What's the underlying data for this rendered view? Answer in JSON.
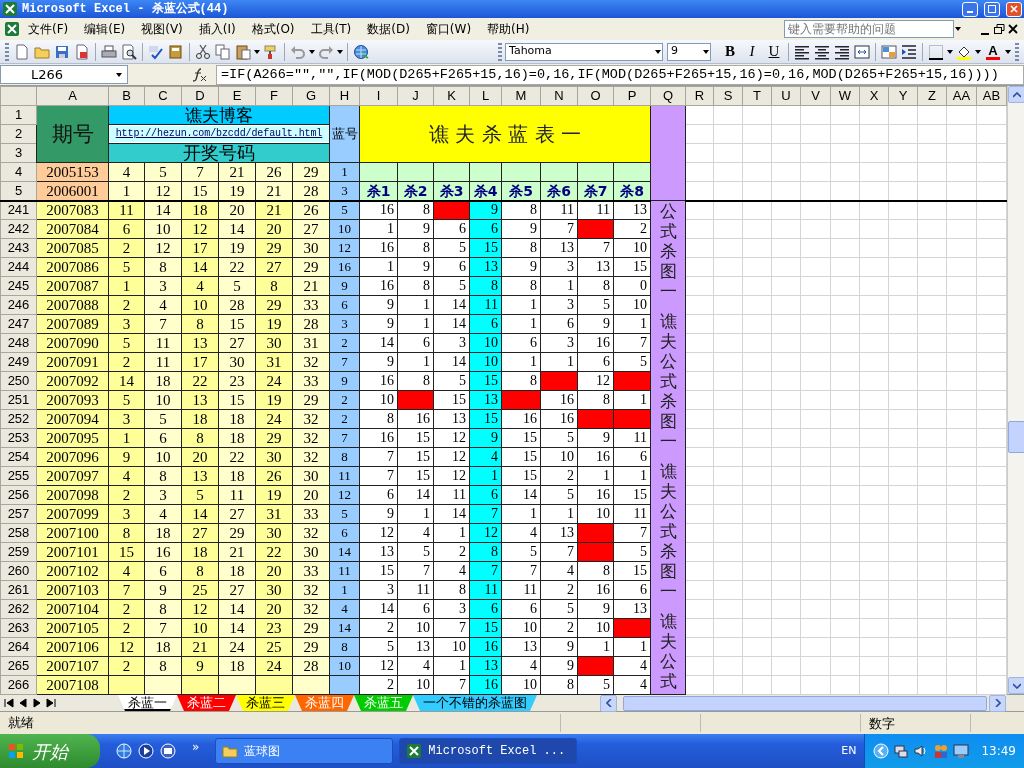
{
  "window": {
    "title": "Microsoft Excel - 杀蓝公式(44)"
  },
  "menu": [
    "文件(F)",
    "编辑(E)",
    "视图(V)",
    "插入(I)",
    "格式(O)",
    "工具(T)",
    "数据(D)",
    "窗口(W)",
    "帮助(H)"
  ],
  "help_box": {
    "placeholder": "键入需要帮助的问题"
  },
  "toolbar": {
    "font": "Tahoma",
    "size": "9",
    "format_buttons": [
      "B",
      "I",
      "U"
    ],
    "font_color_letter": "A"
  },
  "formula_bar": {
    "name_box": "L266",
    "formula": "=IF(A266=\"\",\"\",IF(MOD(D265+F265+15,16)=0,16,IF(MOD(D265+F265+15,16)=0,16,MOD(D265+F265+15,16))))"
  },
  "sheet": {
    "columns": [
      "A",
      "B",
      "C",
      "D",
      "E",
      "F",
      "G",
      "H",
      "I",
      "J",
      "K",
      "L",
      "M",
      "N",
      "O",
      "P",
      "Q",
      "R",
      "S",
      "T",
      "U",
      "V",
      "W",
      "X",
      "Y",
      "Z",
      "AA",
      "AB"
    ],
    "header": {
      "rows": [
        "1",
        "2",
        "3",
        "4",
        "5"
      ],
      "issue_label": "期号",
      "blog": "谯夫博客",
      "link": "http://hezun.com/bzcdd/default.html",
      "numbers_label": "开奖号码",
      "blue_label": "蓝号",
      "title": "谯 夫 杀 蓝 表 一",
      "seed_rows": [
        {
          "issue": "2005153",
          "numbers": [
            "4",
            "5",
            "7",
            "21",
            "26",
            "29"
          ],
          "blue": "1"
        },
        {
          "issue": "2006001",
          "numbers": [
            "1",
            "12",
            "15",
            "19",
            "21",
            "28"
          ],
          "blue": "3"
        }
      ],
      "kill_labels": [
        "杀1",
        "杀2",
        "杀3",
        "杀4",
        "杀5",
        "杀6",
        "杀7",
        "杀8"
      ]
    },
    "rows": [
      {
        "row": "241",
        "issue": "2007083",
        "numbers": [
          "11",
          "14",
          "18",
          "20",
          "21",
          "26"
        ],
        "blue": "5",
        "kills": [
          {
            "value": "16",
            "hit": false
          },
          {
            "value": "8",
            "hit": false
          },
          {
            "hit": true
          },
          {
            "value": "9",
            "hit": false
          },
          {
            "value": "8",
            "hit": false
          },
          {
            "value": "11",
            "hit": false
          },
          {
            "value": "11",
            "hit": false
          },
          {
            "value": "13",
            "hit": false
          }
        ]
      },
      {
        "row": "242",
        "issue": "2007084",
        "numbers": [
          "6",
          "10",
          "12",
          "14",
          "20",
          "27"
        ],
        "blue": "10",
        "kills": [
          {
            "value": "1",
            "hit": false
          },
          {
            "value": "9",
            "hit": false
          },
          {
            "value": "6",
            "hit": false
          },
          {
            "value": "6",
            "hit": false
          },
          {
            "value": "9",
            "hit": false
          },
          {
            "value": "7",
            "hit": false
          },
          {
            "hit": true
          },
          {
            "value": "2",
            "hit": false
          }
        ]
      },
      {
        "row": "243",
        "issue": "2007085",
        "numbers": [
          "2",
          "12",
          "17",
          "19",
          "29",
          "30"
        ],
        "blue": "12",
        "kills": [
          {
            "value": "16",
            "hit": false
          },
          {
            "value": "8",
            "hit": false
          },
          {
            "value": "5",
            "hit": false
          },
          {
            "value": "15",
            "hit": false
          },
          {
            "value": "8",
            "hit": false
          },
          {
            "value": "13",
            "hit": false
          },
          {
            "value": "7",
            "hit": false
          },
          {
            "value": "10",
            "hit": false
          }
        ]
      },
      {
        "row": "244",
        "issue": "2007086",
        "numbers": [
          "5",
          "8",
          "14",
          "22",
          "27",
          "29"
        ],
        "blue": "16",
        "kills": [
          {
            "value": "1",
            "hit": false
          },
          {
            "value": "9",
            "hit": false
          },
          {
            "value": "6",
            "hit": false
          },
          {
            "value": "13",
            "hit": false
          },
          {
            "value": "9",
            "hit": false
          },
          {
            "value": "3",
            "hit": false
          },
          {
            "value": "13",
            "hit": false
          },
          {
            "value": "15",
            "hit": false
          }
        ]
      },
      {
        "row": "245",
        "issue": "2007087",
        "numbers": [
          "1",
          "3",
          "4",
          "5",
          "8",
          "21"
        ],
        "blue": "9",
        "kills": [
          {
            "value": "16",
            "hit": false
          },
          {
            "value": "8",
            "hit": false
          },
          {
            "value": "5",
            "hit": false
          },
          {
            "value": "8",
            "hit": false
          },
          {
            "value": "8",
            "hit": false
          },
          {
            "value": "1",
            "hit": false
          },
          {
            "value": "8",
            "hit": false
          },
          {
            "value": "0",
            "hit": false
          }
        ]
      },
      {
        "row": "246",
        "issue": "2007088",
        "numbers": [
          "2",
          "4",
          "10",
          "28",
          "29",
          "33"
        ],
        "blue": "6",
        "kills": [
          {
            "value": "9",
            "hit": false
          },
          {
            "value": "1",
            "hit": false
          },
          {
            "value": "14",
            "hit": false
          },
          {
            "value": "11",
            "hit": false
          },
          {
            "value": "1",
            "hit": false
          },
          {
            "value": "3",
            "hit": false
          },
          {
            "value": "5",
            "hit": false
          },
          {
            "value": "10",
            "hit": false
          }
        ]
      },
      {
        "row": "247",
        "issue": "2007089",
        "numbers": [
          "3",
          "7",
          "8",
          "15",
          "19",
          "28"
        ],
        "blue": "3",
        "kills": [
          {
            "value": "9",
            "hit": false
          },
          {
            "value": "1",
            "hit": false
          },
          {
            "value": "14",
            "hit": false
          },
          {
            "value": "6",
            "hit": false
          },
          {
            "value": "1",
            "hit": false
          },
          {
            "value": "6",
            "hit": false
          },
          {
            "value": "9",
            "hit": false
          },
          {
            "value": "1",
            "hit": false
          }
        ]
      },
      {
        "row": "248",
        "issue": "2007090",
        "numbers": [
          "5",
          "11",
          "13",
          "27",
          "30",
          "31"
        ],
        "blue": "2",
        "kills": [
          {
            "value": "14",
            "hit": false
          },
          {
            "value": "6",
            "hit": false
          },
          {
            "value": "3",
            "hit": false
          },
          {
            "value": "10",
            "hit": false
          },
          {
            "value": "6",
            "hit": false
          },
          {
            "value": "3",
            "hit": false
          },
          {
            "value": "16",
            "hit": false
          },
          {
            "value": "7",
            "hit": false
          }
        ]
      },
      {
        "row": "249",
        "issue": "2007091",
        "numbers": [
          "2",
          "11",
          "17",
          "30",
          "31",
          "32"
        ],
        "blue": "7",
        "kills": [
          {
            "value": "9",
            "hit": false
          },
          {
            "value": "1",
            "hit": false
          },
          {
            "value": "14",
            "hit": false
          },
          {
            "value": "10",
            "hit": false
          },
          {
            "value": "1",
            "hit": false
          },
          {
            "value": "1",
            "hit": false
          },
          {
            "value": "6",
            "hit": false
          },
          {
            "value": "5",
            "hit": false
          }
        ]
      },
      {
        "row": "250",
        "issue": "2007092",
        "numbers": [
          "14",
          "18",
          "22",
          "23",
          "24",
          "33"
        ],
        "blue": "9",
        "kills": [
          {
            "value": "16",
            "hit": false
          },
          {
            "value": "8",
            "hit": false
          },
          {
            "value": "5",
            "hit": false
          },
          {
            "value": "15",
            "hit": false
          },
          {
            "value": "8",
            "hit": false
          },
          {
            "hit": true
          },
          {
            "value": "12",
            "hit": false
          },
          {
            "hit": true
          }
        ]
      },
      {
        "row": "251",
        "issue": "2007093",
        "numbers": [
          "5",
          "10",
          "13",
          "15",
          "19",
          "29"
        ],
        "blue": "2",
        "kills": [
          {
            "value": "10",
            "hit": false
          },
          {
            "hit": true
          },
          {
            "value": "15",
            "hit": false
          },
          {
            "value": "13",
            "hit": false
          },
          {
            "hit": true
          },
          {
            "value": "16",
            "hit": false
          },
          {
            "value": "8",
            "hit": false
          },
          {
            "value": "1",
            "hit": false
          }
        ]
      },
      {
        "row": "252",
        "issue": "2007094",
        "numbers": [
          "3",
          "5",
          "18",
          "18",
          "24",
          "32"
        ],
        "blue": "2",
        "kills": [
          {
            "value": "8",
            "hit": false
          },
          {
            "value": "16",
            "hit": false
          },
          {
            "value": "13",
            "hit": false
          },
          {
            "value": "15",
            "hit": false
          },
          {
            "value": "16",
            "hit": false
          },
          {
            "value": "16",
            "hit": false
          },
          {
            "hit": true
          },
          {
            "hit": true
          }
        ]
      },
      {
        "row": "253",
        "issue": "2007095",
        "numbers": [
          "1",
          "6",
          "8",
          "18",
          "29",
          "32"
        ],
        "blue": "7",
        "kills": [
          {
            "value": "16",
            "hit": false
          },
          {
            "value": "15",
            "hit": false
          },
          {
            "value": "12",
            "hit": false
          },
          {
            "value": "9",
            "hit": false
          },
          {
            "value": "15",
            "hit": false
          },
          {
            "value": "5",
            "hit": false
          },
          {
            "value": "9",
            "hit": false
          },
          {
            "value": "11",
            "hit": false
          }
        ]
      },
      {
        "row": "254",
        "issue": "2007096",
        "numbers": [
          "9",
          "10",
          "20",
          "22",
          "30",
          "32"
        ],
        "blue": "8",
        "kills": [
          {
            "value": "7",
            "hit": false
          },
          {
            "value": "15",
            "hit": false
          },
          {
            "value": "12",
            "hit": false
          },
          {
            "value": "4",
            "hit": false
          },
          {
            "value": "15",
            "hit": false
          },
          {
            "value": "10",
            "hit": false
          },
          {
            "value": "16",
            "hit": false
          },
          {
            "value": "6",
            "hit": false
          }
        ]
      },
      {
        "row": "255",
        "issue": "2007097",
        "numbers": [
          "4",
          "8",
          "13",
          "18",
          "26",
          "30"
        ],
        "blue": "11",
        "kills": [
          {
            "value": "7",
            "hit": false
          },
          {
            "value": "15",
            "hit": false
          },
          {
            "value": "12",
            "hit": false
          },
          {
            "value": "1",
            "hit": false
          },
          {
            "value": "15",
            "hit": false
          },
          {
            "value": "2",
            "hit": false
          },
          {
            "value": "1",
            "hit": false
          },
          {
            "value": "1",
            "hit": false
          }
        ]
      },
      {
        "row": "256",
        "issue": "2007098",
        "numbers": [
          "2",
          "3",
          "5",
          "11",
          "19",
          "20"
        ],
        "blue": "12",
        "kills": [
          {
            "value": "6",
            "hit": false
          },
          {
            "value": "14",
            "hit": false
          },
          {
            "value": "11",
            "hit": false
          },
          {
            "value": "6",
            "hit": false
          },
          {
            "value": "14",
            "hit": false
          },
          {
            "value": "5",
            "hit": false
          },
          {
            "value": "16",
            "hit": false
          },
          {
            "value": "15",
            "hit": false
          }
        ]
      },
      {
        "row": "257",
        "issue": "2007099",
        "numbers": [
          "3",
          "4",
          "14",
          "27",
          "31",
          "33"
        ],
        "blue": "5",
        "kills": [
          {
            "value": "9",
            "hit": false
          },
          {
            "value": "1",
            "hit": false
          },
          {
            "value": "14",
            "hit": false
          },
          {
            "value": "7",
            "hit": false
          },
          {
            "value": "1",
            "hit": false
          },
          {
            "value": "1",
            "hit": false
          },
          {
            "value": "10",
            "hit": false
          },
          {
            "value": "11",
            "hit": false
          }
        ]
      },
      {
        "row": "258",
        "issue": "2007100",
        "numbers": [
          "8",
          "18",
          "27",
          "29",
          "30",
          "32"
        ],
        "blue": "6",
        "kills": [
          {
            "value": "12",
            "hit": false
          },
          {
            "value": "4",
            "hit": false
          },
          {
            "value": "1",
            "hit": false
          },
          {
            "value": "12",
            "hit": false
          },
          {
            "value": "4",
            "hit": false
          },
          {
            "value": "13",
            "hit": false
          },
          {
            "hit": true
          },
          {
            "value": "7",
            "hit": false
          }
        ]
      },
      {
        "row": "259",
        "issue": "2007101",
        "numbers": [
          "15",
          "16",
          "18",
          "21",
          "22",
          "30"
        ],
        "blue": "14",
        "kills": [
          {
            "value": "13",
            "hit": false
          },
          {
            "value": "5",
            "hit": false
          },
          {
            "value": "2",
            "hit": false
          },
          {
            "value": "8",
            "hit": false
          },
          {
            "value": "5",
            "hit": false
          },
          {
            "value": "7",
            "hit": false
          },
          {
            "hit": true
          },
          {
            "value": "5",
            "hit": false
          }
        ]
      },
      {
        "row": "260",
        "issue": "2007102",
        "numbers": [
          "4",
          "6",
          "8",
          "18",
          "20",
          "33"
        ],
        "blue": "11",
        "kills": [
          {
            "value": "15",
            "hit": false
          },
          {
            "value": "7",
            "hit": false
          },
          {
            "value": "4",
            "hit": false
          },
          {
            "value": "7",
            "hit": false
          },
          {
            "value": "7",
            "hit": false
          },
          {
            "value": "4",
            "hit": false
          },
          {
            "value": "8",
            "hit": false
          },
          {
            "value": "15",
            "hit": false
          }
        ]
      },
      {
        "row": "261",
        "issue": "2007103",
        "numbers": [
          "7",
          "9",
          "25",
          "27",
          "30",
          "32"
        ],
        "blue": "1",
        "kills": [
          {
            "value": "3",
            "hit": false
          },
          {
            "value": "11",
            "hit": false
          },
          {
            "value": "8",
            "hit": false
          },
          {
            "value": "11",
            "hit": false
          },
          {
            "value": "11",
            "hit": false
          },
          {
            "value": "2",
            "hit": false
          },
          {
            "value": "16",
            "hit": false
          },
          {
            "value": "6",
            "hit": false
          }
        ]
      },
      {
        "row": "262",
        "issue": "2007104",
        "numbers": [
          "2",
          "8",
          "12",
          "14",
          "20",
          "32"
        ],
        "blue": "4",
        "kills": [
          {
            "value": "14",
            "hit": false
          },
          {
            "value": "6",
            "hit": false
          },
          {
            "value": "3",
            "hit": false
          },
          {
            "value": "6",
            "hit": false
          },
          {
            "value": "6",
            "hit": false
          },
          {
            "value": "5",
            "hit": false
          },
          {
            "value": "9",
            "hit": false
          },
          {
            "value": "13",
            "hit": false
          }
        ]
      },
      {
        "row": "263",
        "issue": "2007105",
        "numbers": [
          "2",
          "7",
          "10",
          "14",
          "23",
          "29"
        ],
        "blue": "14",
        "kills": [
          {
            "value": "2",
            "hit": false
          },
          {
            "value": "10",
            "hit": false
          },
          {
            "value": "7",
            "hit": false
          },
          {
            "value": "15",
            "hit": false
          },
          {
            "value": "10",
            "hit": false
          },
          {
            "value": "2",
            "hit": false
          },
          {
            "value": "10",
            "hit": false
          },
          {
            "hit": true
          }
        ]
      },
      {
        "row": "264",
        "issue": "2007106",
        "numbers": [
          "12",
          "18",
          "21",
          "24",
          "25",
          "29"
        ],
        "blue": "8",
        "kills": [
          {
            "value": "5",
            "hit": false
          },
          {
            "value": "13",
            "hit": false
          },
          {
            "value": "10",
            "hit": false
          },
          {
            "value": "16",
            "hit": false
          },
          {
            "value": "13",
            "hit": false
          },
          {
            "value": "9",
            "hit": false
          },
          {
            "value": "1",
            "hit": false
          },
          {
            "value": "1",
            "hit": false
          }
        ]
      },
      {
        "row": "265",
        "issue": "2007107",
        "numbers": [
          "2",
          "8",
          "9",
          "18",
          "24",
          "28"
        ],
        "blue": "10",
        "kills": [
          {
            "value": "12",
            "hit": false
          },
          {
            "value": "4",
            "hit": false
          },
          {
            "value": "1",
            "hit": false
          },
          {
            "value": "13",
            "hit": false
          },
          {
            "value": "4",
            "hit": false
          },
          {
            "value": "9",
            "hit": false
          },
          {
            "hit": true
          },
          {
            "value": "4",
            "hit": false
          }
        ]
      },
      {
        "row": "266",
        "issue": "2007108",
        "kills": [
          {
            "value": "2",
            "hit": false
          },
          {
            "value": "10",
            "hit": false
          },
          {
            "value": "7",
            "hit": false
          },
          {
            "value": "16",
            "hit": false
          },
          {
            "value": "10",
            "hit": false
          },
          {
            "value": "8",
            "hit": false
          },
          {
            "value": "5",
            "hit": false
          },
          {
            "value": "4",
            "hit": false
          }
        ]
      }
    ],
    "side_text": [
      "公式杀图一",
      "谯夫公式杀图一",
      "谯夫公式杀图一",
      "谯夫公式"
    ]
  },
  "sheet_tabs": [
    {
      "label": "杀蓝一",
      "selected": true
    },
    {
      "label": "杀蓝二",
      "selected": false,
      "color": "#ff0000"
    },
    {
      "label": "杀蓝三",
      "selected": false,
      "color": "#ffff00"
    },
    {
      "label": "杀蓝四",
      "selected": false,
      "color": "#ff6600"
    },
    {
      "label": "杀蓝五",
      "selected": false,
      "color": "#00cc00"
    },
    {
      "label": "一个不错的杀蓝图",
      "selected": false,
      "color": "#33ccff"
    }
  ],
  "status_bar": {
    "left": "就绪",
    "mode": "数字"
  },
  "taskbar": {
    "start": "开始",
    "more": "»",
    "tasks": [
      {
        "label": "蓝球图",
        "selected": false,
        "kind": "folder"
      },
      {
        "label": "Microsoft Excel ...",
        "selected": true,
        "kind": "excel"
      }
    ],
    "language": "EN",
    "clock": "13:49"
  }
}
